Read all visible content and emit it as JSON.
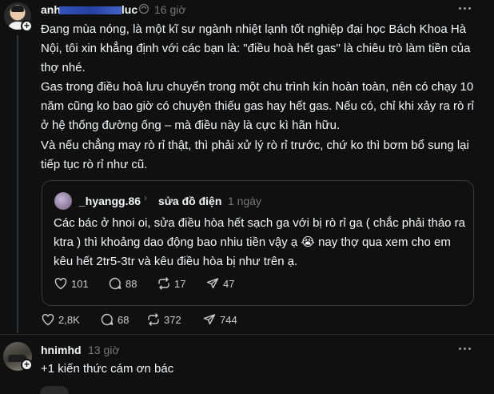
{
  "post": {
    "username_visible": "anh",
    "username_tail": "luc",
    "time": "16 giờ",
    "paragraphs": [
      "Đang mùa nóng, là một kĩ sư ngành nhiệt lạnh tốt nghiệp đại học Bách Khoa Hà Nội, tôi xin khẳng định với các bạn là: \"điều hoà hết gas\" là chiêu trò làm tiền của thợ nhé.",
      "Gas trong điều hoà lưu chuyển trong một chu trình kín hoàn toàn, nên có chạy 10 năm cũng ko bao giờ có chuyện thiếu gas hay hết gas. Nếu có, chỉ khi xảy ra rò rỉ ở hệ thống đường ống – mà điều này là cực kì hãn hữu.",
      "Và nếu chẳng may rò rỉ thật, thì phải xử lý rò rỉ trước, chứ ko thì bơm bổ sung lại tiếp tục rò rỉ như cũ."
    ],
    "quote": {
      "username": "_hyangg.86",
      "separator": "›",
      "topic": "sửa đồ điện",
      "time": "1 ngày",
      "text": "Các bác ở hnoi oi, sửa điều hòa hết sạch ga với bị rò rỉ ga ( chắc phải tháo ra ktra ) thì khoảng dao động bao nhiu tiền vậy ạ 😭 nay thợ qua xem cho em kêu hết 2tr5-3tr và kêu điều hòa bị như trên ạ.",
      "stats": {
        "likes": "101",
        "comments": "88",
        "reposts": "17",
        "shares": "47"
      }
    },
    "stats": {
      "likes": "2,8K",
      "comments": "68",
      "reposts": "372",
      "shares": "744"
    }
  },
  "reply": {
    "username": "hnimhd",
    "time": "13 giờ",
    "text": "+1 kiến thức cám ơn bác"
  },
  "icons": [
    "plus-icon",
    "repost-small-icon",
    "more-icon",
    "heart-icon",
    "comment-icon",
    "repost-icon",
    "share-icon"
  ],
  "colors": {
    "background": "#101010",
    "text": "#f3f5f7",
    "muted": "#777777",
    "border": "#3a3a3a"
  }
}
